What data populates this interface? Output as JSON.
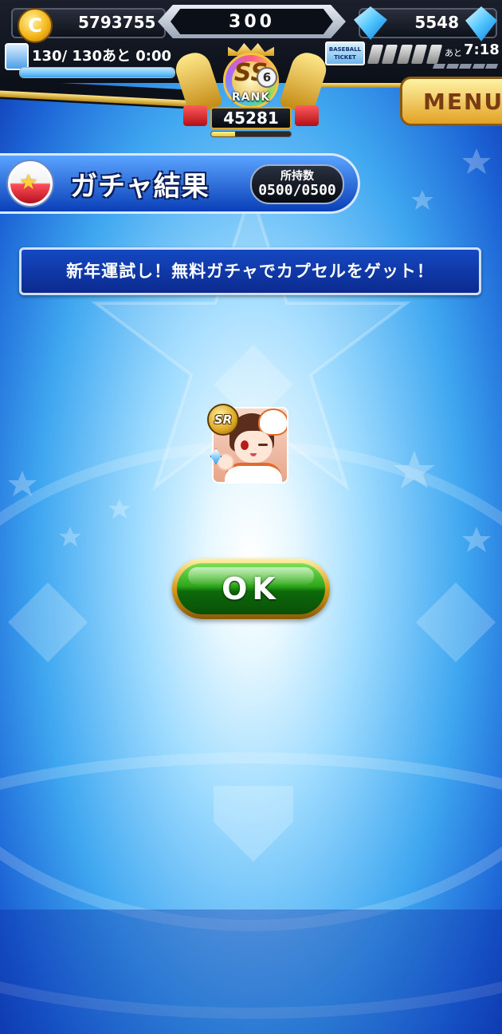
{
  "hud": {
    "coins": "5793755",
    "center_counter": "300",
    "gems": "5548",
    "stamina_text": "130/ 130あと 0:00",
    "stamina_fraction": 1.0,
    "ticket_label": "BASEBALL TICKET",
    "ticket_remaining_label": "あと",
    "ticket_timer": "7:18",
    "rank_letters": "SS",
    "rank_level": "6",
    "rank_word": "RANK",
    "rank_points": "45281",
    "rank_progress_fraction": 0.3,
    "coin_symbol": "C",
    "menu_label": "MENU"
  },
  "gacha": {
    "title": "ガチャ結果",
    "holdings_label": "所持数",
    "holdings_value": "0500/0500"
  },
  "message": "新年運試し！無料ガチャでカプセルをゲット！",
  "result_card": {
    "rarity": "SR"
  },
  "ok_button": {
    "label": "OK"
  },
  "colors": {
    "accent_gold": "#e2a224",
    "panel_blue": "#0b2a8e",
    "ok_green": "#2ea61a"
  }
}
